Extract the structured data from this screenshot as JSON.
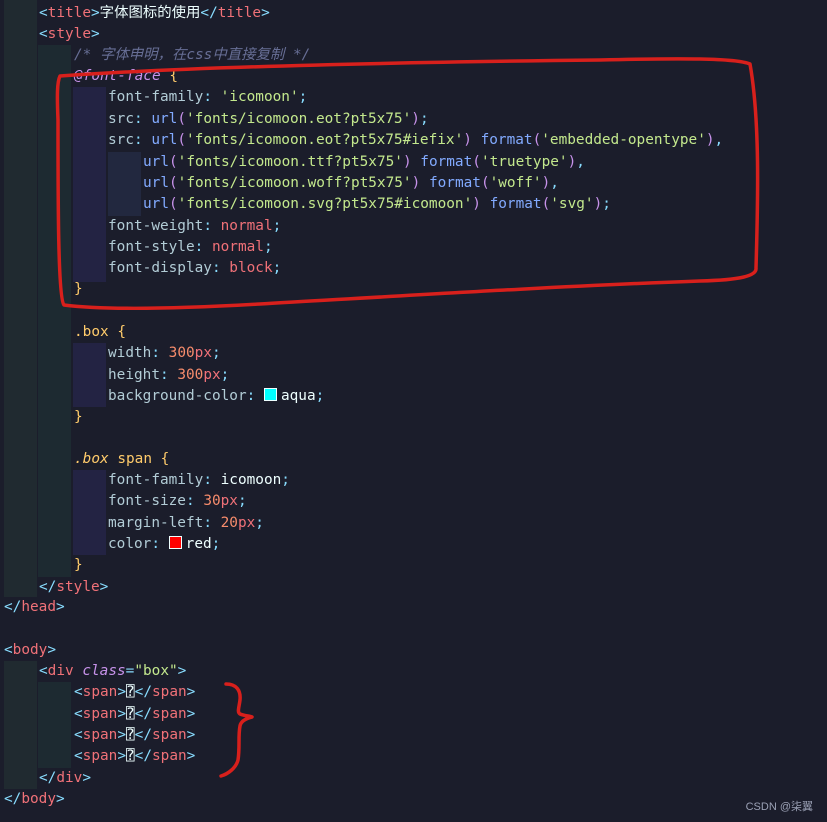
{
  "lines": [
    [
      [
        "t-tag",
        "<"
      ],
      [
        "t-tname",
        "title"
      ],
      [
        "t-tag",
        ">"
      ],
      [
        "t-txt",
        "字体图标的使用"
      ],
      [
        "t-tag",
        "</"
      ],
      [
        "t-tname",
        "title"
      ],
      [
        "t-tag",
        ">"
      ]
    ],
    [
      [
        "t-tag",
        "<"
      ],
      [
        "t-tname",
        "style"
      ],
      [
        "t-tag",
        ">"
      ]
    ],
    [
      [
        "t-com",
        "/* 字体申明，在css中直接复制 */"
      ]
    ],
    [
      [
        "t-at",
        "@font-face"
      ],
      [
        "t-txt",
        " "
      ],
      [
        "t-brace",
        "{"
      ]
    ],
    [
      [
        "t-prop",
        "font-family"
      ],
      [
        "t-punc",
        ": "
      ],
      [
        "t-str",
        "'icomoon'"
      ],
      [
        "t-punc",
        ";"
      ]
    ],
    [
      [
        "t-prop",
        "src"
      ],
      [
        "t-punc",
        ": "
      ],
      [
        "t-fn",
        "url"
      ],
      [
        "t-paren",
        "("
      ],
      [
        "t-str",
        "'fonts/icomoon.eot?pt5x75'"
      ],
      [
        "t-paren",
        ")"
      ],
      [
        "t-punc",
        ";"
      ]
    ],
    [
      [
        "t-prop",
        "src"
      ],
      [
        "t-punc",
        ": "
      ],
      [
        "t-fn",
        "url"
      ],
      [
        "t-paren",
        "("
      ],
      [
        "t-str",
        "'fonts/icomoon.eot?pt5x75#iefix'"
      ],
      [
        "t-paren",
        ")"
      ],
      [
        "t-txt",
        " "
      ],
      [
        "t-fn",
        "format"
      ],
      [
        "t-paren",
        "("
      ],
      [
        "t-str",
        "'embedded-opentype'"
      ],
      [
        "t-paren",
        ")"
      ],
      [
        "t-punc",
        ","
      ]
    ],
    [
      [
        "t-fn",
        "url"
      ],
      [
        "t-paren",
        "("
      ],
      [
        "t-str",
        "'fonts/icomoon.ttf?pt5x75'"
      ],
      [
        "t-paren",
        ")"
      ],
      [
        "t-txt",
        " "
      ],
      [
        "t-fn",
        "format"
      ],
      [
        "t-paren",
        "("
      ],
      [
        "t-str",
        "'truetype'"
      ],
      [
        "t-paren",
        ")"
      ],
      [
        "t-punc",
        ","
      ]
    ],
    [
      [
        "t-fn",
        "url"
      ],
      [
        "t-paren",
        "("
      ],
      [
        "t-str",
        "'fonts/icomoon.woff?pt5x75'"
      ],
      [
        "t-paren",
        ")"
      ],
      [
        "t-txt",
        " "
      ],
      [
        "t-fn",
        "format"
      ],
      [
        "t-paren",
        "("
      ],
      [
        "t-str",
        "'woff'"
      ],
      [
        "t-paren",
        ")"
      ],
      [
        "t-punc",
        ","
      ]
    ],
    [
      [
        "t-fn",
        "url"
      ],
      [
        "t-paren",
        "("
      ],
      [
        "t-str",
        "'fonts/icomoon.svg?pt5x75#icomoon'"
      ],
      [
        "t-paren",
        ")"
      ],
      [
        "t-txt",
        " "
      ],
      [
        "t-fn",
        "format"
      ],
      [
        "t-paren",
        "("
      ],
      [
        "t-str",
        "'svg'"
      ],
      [
        "t-paren",
        ")"
      ],
      [
        "t-punc",
        ";"
      ]
    ],
    [
      [
        "t-prop",
        "font-weight"
      ],
      [
        "t-punc",
        ": "
      ],
      [
        "t-kw",
        "normal"
      ],
      [
        "t-punc",
        ";"
      ]
    ],
    [
      [
        "t-prop",
        "font-style"
      ],
      [
        "t-punc",
        ": "
      ],
      [
        "t-kw",
        "normal"
      ],
      [
        "t-punc",
        ";"
      ]
    ],
    [
      [
        "t-prop",
        "font-display"
      ],
      [
        "t-punc",
        ": "
      ],
      [
        "t-kw",
        "block"
      ],
      [
        "t-punc",
        ";"
      ]
    ],
    [
      [
        "t-brace",
        "}"
      ]
    ],
    [],
    [
      [
        "t-sel",
        ".box"
      ],
      [
        "t-txt",
        " "
      ],
      [
        "t-brace",
        "{"
      ]
    ],
    [
      [
        "t-prop",
        "width"
      ],
      [
        "t-punc",
        ": "
      ],
      [
        "t-num",
        "300"
      ],
      [
        "t-kw",
        "px"
      ],
      [
        "t-punc",
        ";"
      ]
    ],
    [
      [
        "t-prop",
        "height"
      ],
      [
        "t-punc",
        ": "
      ],
      [
        "t-num",
        "300"
      ],
      [
        "t-kw",
        "px"
      ],
      [
        "t-punc",
        ";"
      ]
    ],
    [
      [
        "t-prop",
        "background-color"
      ],
      [
        "t-punc",
        ": "
      ],
      [
        "swatch",
        "#00ffff"
      ],
      [
        "t-txt",
        "aqua"
      ],
      [
        "t-punc",
        ";"
      ]
    ],
    [
      [
        "t-brace",
        "}"
      ]
    ],
    [],
    [
      [
        "t-sel-it",
        ".box"
      ],
      [
        "t-txt",
        " "
      ],
      [
        "t-sel",
        "span"
      ],
      [
        "t-txt",
        " "
      ],
      [
        "t-brace",
        "{"
      ]
    ],
    [
      [
        "t-prop",
        "font-family"
      ],
      [
        "t-punc",
        ": "
      ],
      [
        "t-txt",
        "icomoon"
      ],
      [
        "t-punc",
        ";"
      ]
    ],
    [
      [
        "t-prop",
        "font-size"
      ],
      [
        "t-punc",
        ": "
      ],
      [
        "t-num",
        "30"
      ],
      [
        "t-kw",
        "px"
      ],
      [
        "t-punc",
        ";"
      ]
    ],
    [
      [
        "t-prop",
        "margin-left"
      ],
      [
        "t-punc",
        ": "
      ],
      [
        "t-num",
        "20"
      ],
      [
        "t-kw",
        "px"
      ],
      [
        "t-punc",
        ";"
      ]
    ],
    [
      [
        "t-prop",
        "color"
      ],
      [
        "t-punc",
        ": "
      ],
      [
        "swatch",
        "#ff0000"
      ],
      [
        "t-txt",
        "red"
      ],
      [
        "t-punc",
        ";"
      ]
    ],
    [
      [
        "t-brace",
        "}"
      ]
    ],
    [
      [
        "t-tag",
        "</"
      ],
      [
        "t-tname",
        "style"
      ],
      [
        "t-tag",
        ">"
      ]
    ],
    [
      [
        "t-tag",
        "</"
      ],
      [
        "t-tname",
        "head"
      ],
      [
        "t-tag",
        ">"
      ]
    ],
    [],
    [
      [
        "t-tag",
        "<"
      ],
      [
        "t-tname",
        "body"
      ],
      [
        "t-tag",
        ">"
      ]
    ],
    [
      [
        "t-tag",
        "<"
      ],
      [
        "t-tname",
        "div"
      ],
      [
        "t-txt",
        " "
      ],
      [
        "t-attr",
        "class"
      ],
      [
        "t-punc",
        "="
      ],
      [
        "t-str",
        "\"box\""
      ],
      [
        "t-tag",
        ">"
      ]
    ],
    [
      [
        "t-tag",
        "<"
      ],
      [
        "t-tname",
        "span"
      ],
      [
        "t-tag",
        ">"
      ],
      [
        "t-txt",
        "⍰"
      ],
      [
        "t-tag",
        "</"
      ],
      [
        "t-tname",
        "span"
      ],
      [
        "t-tag",
        ">"
      ]
    ],
    [
      [
        "t-tag",
        "<"
      ],
      [
        "t-tname",
        "span"
      ],
      [
        "t-tag",
        ">"
      ],
      [
        "t-txt",
        "⍰"
      ],
      [
        "t-tag",
        "</"
      ],
      [
        "t-tname",
        "span"
      ],
      [
        "t-tag",
        ">"
      ]
    ],
    [
      [
        "t-tag",
        "<"
      ],
      [
        "t-tname",
        "span"
      ],
      [
        "t-tag",
        ">"
      ],
      [
        "t-txt",
        "⍰"
      ],
      [
        "t-tag",
        "</"
      ],
      [
        "t-tname",
        "span"
      ],
      [
        "t-tag",
        ">"
      ]
    ],
    [
      [
        "t-tag",
        "<"
      ],
      [
        "t-tname",
        "span"
      ],
      [
        "t-tag",
        ">"
      ],
      [
        "t-txt",
        "⍰"
      ],
      [
        "t-tag",
        "</"
      ],
      [
        "t-tname",
        "span"
      ],
      [
        "t-tag",
        ">"
      ]
    ],
    [
      [
        "t-tag",
        "</"
      ],
      [
        "t-tname",
        "div"
      ],
      [
        "t-tag",
        ">"
      ]
    ],
    [
      [
        "t-tag",
        "</"
      ],
      [
        "t-tname",
        "body"
      ],
      [
        "t-tag",
        ">"
      ]
    ]
  ],
  "watermark": "CSDN @柒翼"
}
